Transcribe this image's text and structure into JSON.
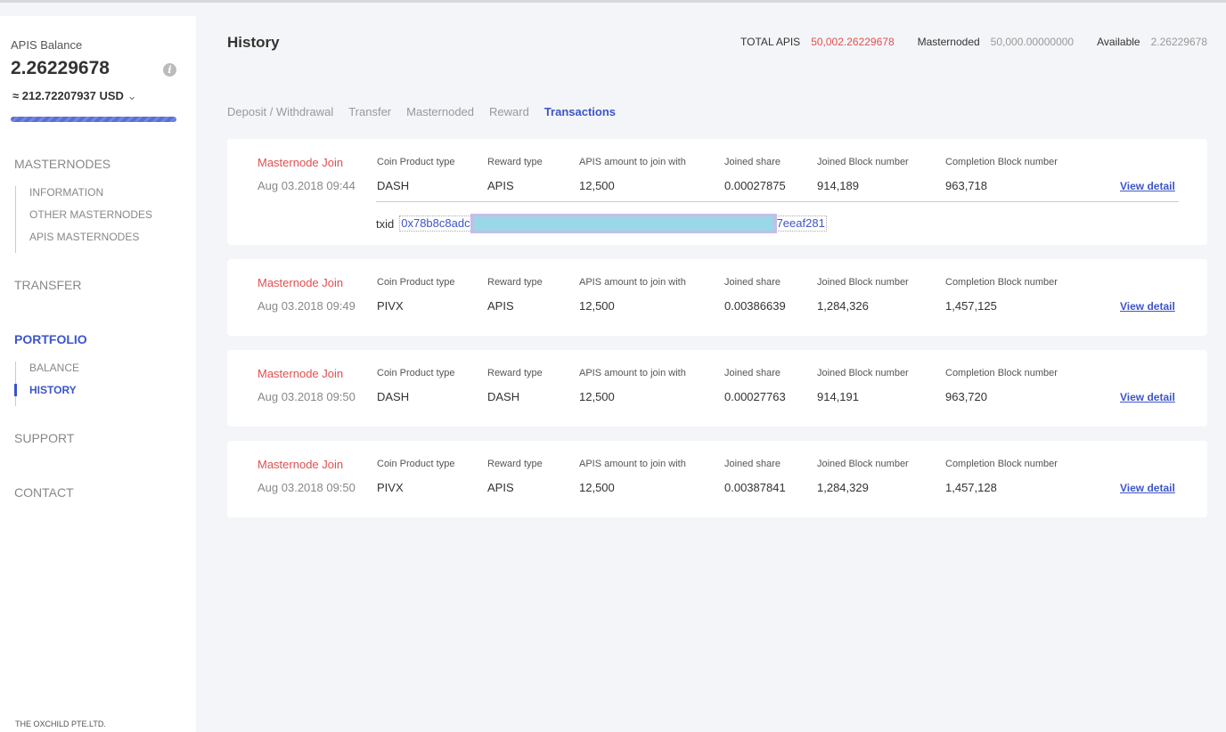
{
  "sidebar": {
    "balance_label": "APIS Balance",
    "balance": "2.26229678",
    "usd": "≈ 212.72207937 USD",
    "nav": {
      "masternodes": "MASTERNODES",
      "information": "INFORMATION",
      "other": "OTHER MASTERNODES",
      "apis": "APIS MASTERNODES",
      "transfer": "TRANSFER",
      "portfolio": "PORTFOLIO",
      "balance": "BALANCE",
      "history": "HISTORY",
      "support": "SUPPORT",
      "contact": "CONTACT"
    },
    "footer": "THE OXCHILD PTE.LTD."
  },
  "header": {
    "title": "History",
    "total_label": "TOTAL APIS",
    "total": "50,002.26229678",
    "masternoded_label": "Masternoded",
    "masternoded": "50,000.00000000",
    "available_label": "Available",
    "available": "2.26229678"
  },
  "tabs": [
    "Deposit / Withdrawal",
    "Transfer",
    "Masternoded",
    "Reward",
    "Transactions"
  ],
  "headers": {
    "coin": "Coin Product type",
    "reward": "Reward type",
    "amount": "APIS amount to join with",
    "share": "Joined share",
    "joined": "Joined Block number",
    "completion": "Completion Block number",
    "view": "View detail"
  },
  "txid_label": "txid",
  "txid_start": "0x78b8c8adc",
  "txid_end": "7eeaf281",
  "rows": [
    {
      "type": "Masternode Join",
      "date": "Aug 03.2018 09:44",
      "coin": "DASH",
      "reward": "APIS",
      "amount": "12,500",
      "share": "0.00027875",
      "joined": "914,189",
      "completion": "963,718"
    },
    {
      "type": "Masternode Join",
      "date": "Aug 03.2018 09:49",
      "coin": "PIVX",
      "reward": "APIS",
      "amount": "12,500",
      "share": "0.00386639",
      "joined": "1,284,326",
      "completion": "1,457,125"
    },
    {
      "type": "Masternode Join",
      "date": "Aug 03.2018 09:50",
      "coin": "DASH",
      "reward": "DASH",
      "amount": "12,500",
      "share": "0.00027763",
      "joined": "914,191",
      "completion": "963,720"
    },
    {
      "type": "Masternode Join",
      "date": "Aug 03.2018 09:50",
      "coin": "PIVX",
      "reward": "APIS",
      "amount": "12,500",
      "share": "0.00387841",
      "joined": "1,284,329",
      "completion": "1,457,128"
    }
  ]
}
